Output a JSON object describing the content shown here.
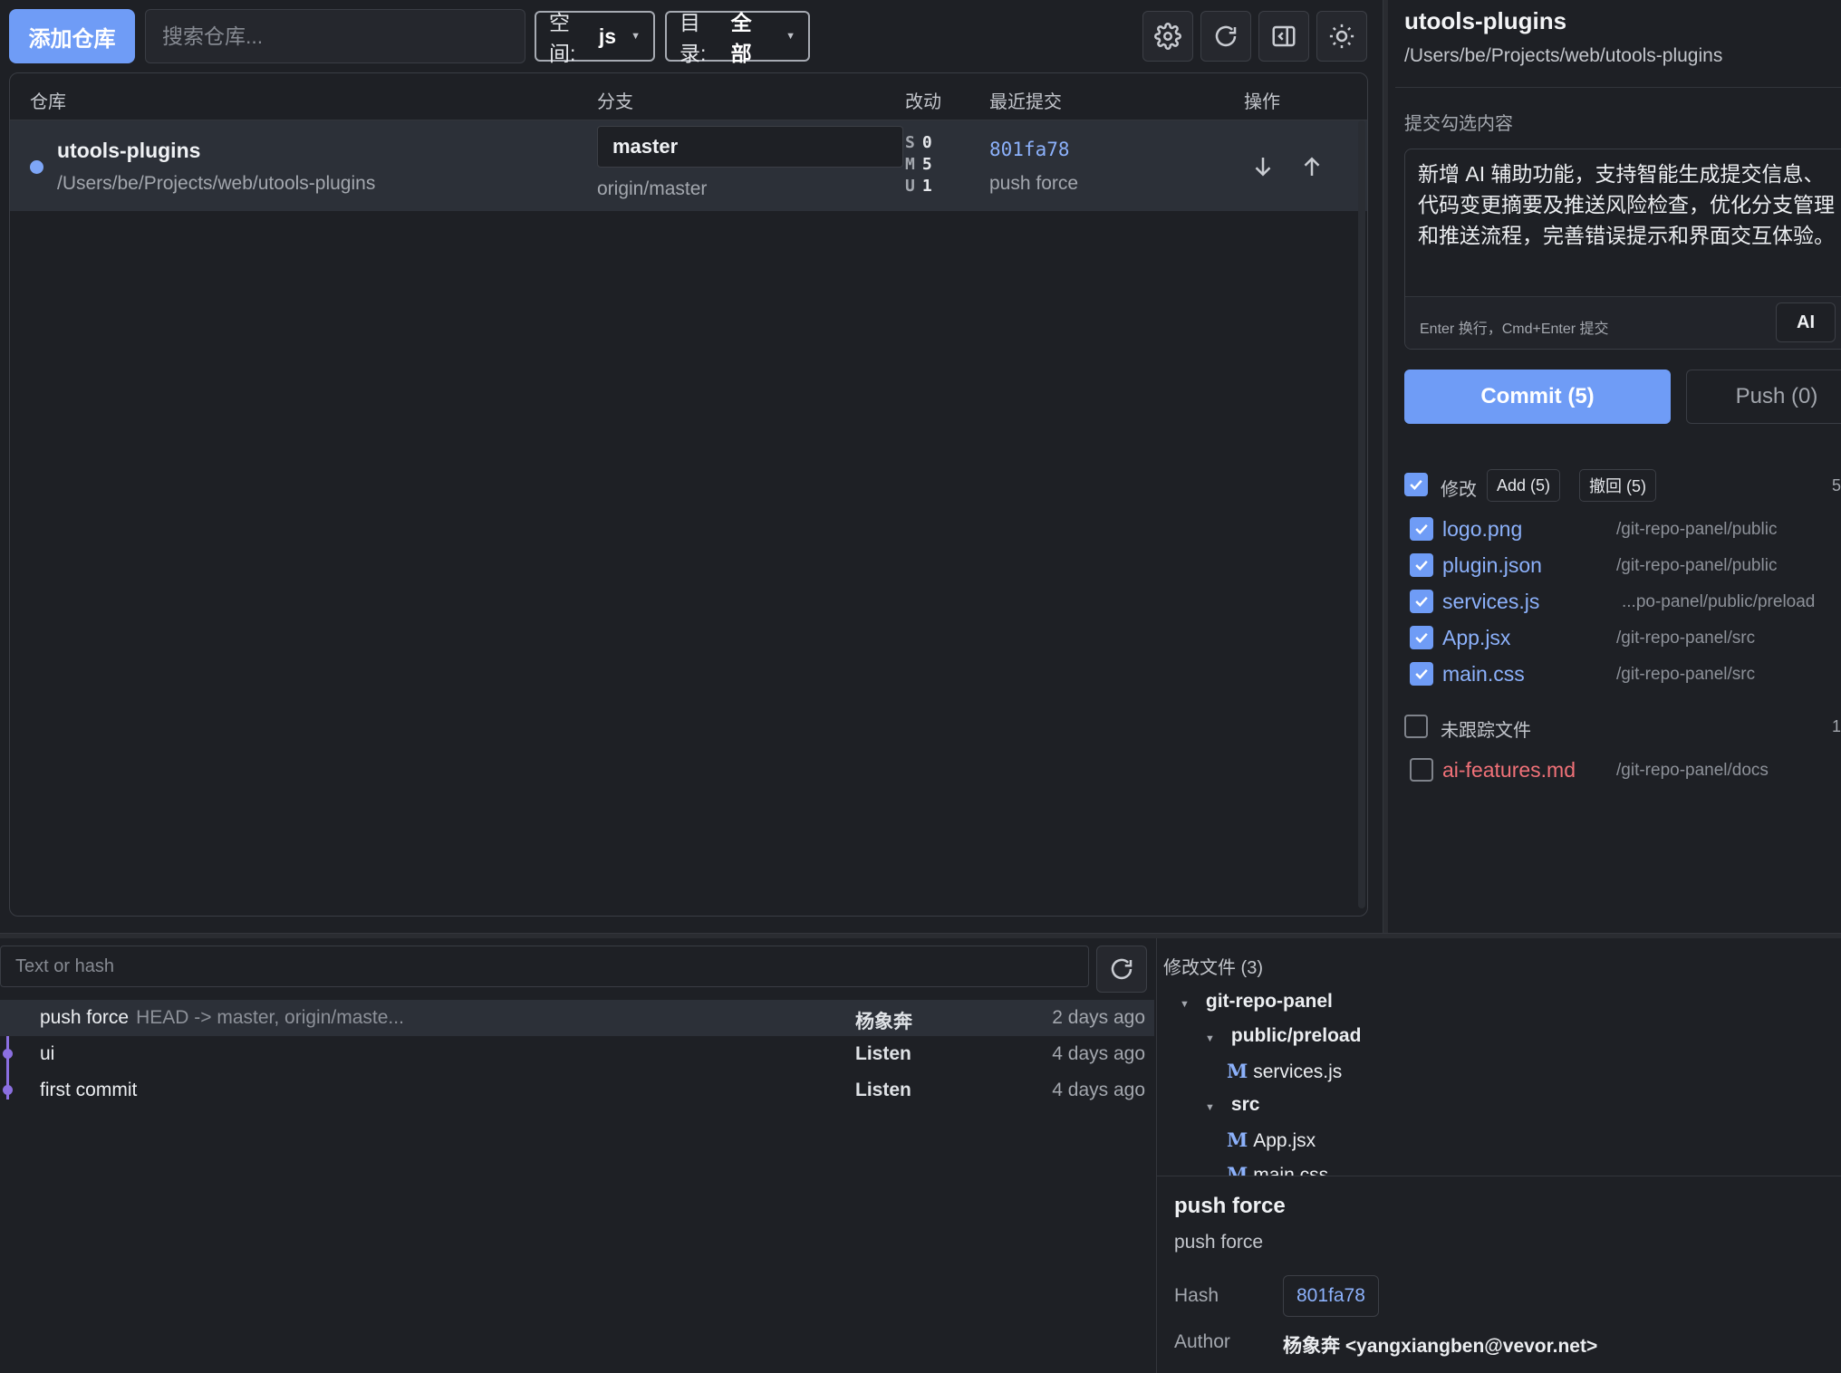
{
  "toolbar": {
    "add_repo_label": "添加仓库",
    "search_placeholder": "搜索仓库...",
    "space_prefix": "空间:",
    "space_value": "js",
    "dir_prefix": "目录:",
    "dir_value": "全部",
    "icons": [
      "gear-icon",
      "refresh-icon",
      "panel-toggle-icon",
      "sun-icon"
    ]
  },
  "table": {
    "headers": {
      "repo": "仓库",
      "branch": "分支",
      "changes": "改动",
      "last_commit": "最近提交",
      "actions": "操作"
    },
    "rows": [
      {
        "name": "utools-plugins",
        "path": "/Users/be/Projects/web/utools-plugins",
        "branch": "master",
        "remote": "origin/master",
        "stats": [
          {
            "key": "S",
            "value": "0"
          },
          {
            "key": "M",
            "value": "5"
          },
          {
            "key": "U",
            "value": "1"
          }
        ],
        "commit_hash": "801fa78",
        "commit_msg": "push force"
      }
    ]
  },
  "right_panel": {
    "title": "utools-plugins",
    "path": "/Users/be/Projects/web/utools-plugins",
    "commit_label": "提交勾选内容",
    "message": "新增 AI 辅助功能，支持智能生成提交信息、代码变更摘要及推送风险检查，优化分支管理和推送流程，完善错误提示和界面交互体验。",
    "hint": "Enter 换行，Cmd+Enter 提交",
    "ai_label": "AI",
    "commit_button": "Commit (5)",
    "push_button": "Push (0)",
    "modified": {
      "label": "修改",
      "add_label": "Add (5)",
      "revert_label": "撤回 (5)",
      "count": "5",
      "files": [
        {
          "name": "logo.png",
          "path": "/git-repo-panel/public"
        },
        {
          "name": "plugin.json",
          "path": "/git-repo-panel/public"
        },
        {
          "name": "services.js",
          "path": "...po-panel/public/preload"
        },
        {
          "name": "App.jsx",
          "path": "/git-repo-panel/src"
        },
        {
          "name": "main.css",
          "path": "/git-repo-panel/src"
        }
      ]
    },
    "untracked": {
      "label": "未跟踪文件",
      "count": "1",
      "files": [
        {
          "name": "ai-features.md",
          "path": "/git-repo-panel/docs"
        }
      ]
    }
  },
  "log": {
    "search_placeholder": "Text or hash",
    "commits": [
      {
        "message": "push force",
        "refs": "HEAD -> master, origin/maste...",
        "author": "杨象奔",
        "time": "2 days ago"
      },
      {
        "message": "ui",
        "refs": "",
        "author": "Listen",
        "time": "4 days ago"
      },
      {
        "message": "first commit",
        "refs": "",
        "author": "Listen",
        "time": "4 days ago"
      }
    ]
  },
  "files_panel": {
    "title": "修改文件 (3)",
    "tree": {
      "root": "git-repo-panel",
      "dir1": "public/preload",
      "file1": "services.js",
      "dir2": "src",
      "file2": "App.jsx",
      "file3": "main.css",
      "mod_tag": "M"
    }
  },
  "detail": {
    "title": "push force",
    "subtitle": "push force",
    "hash_label": "Hash",
    "hash": "801fa78",
    "author_label": "Author",
    "author": "杨象奔 <yangxiangben@vevor.net>"
  }
}
